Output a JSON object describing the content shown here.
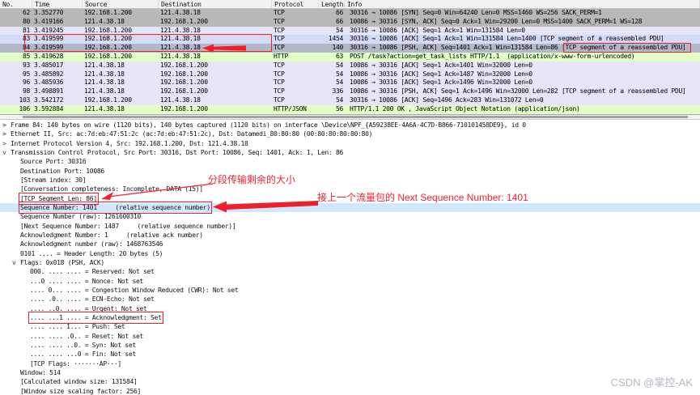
{
  "colors": {
    "gray_row": "#b8b8b8",
    "lavender_row": "#e7e6f8",
    "blue_row": "#d6dbf5",
    "selected_row": "#b4b6ca",
    "green_row": "#e3ffc8",
    "detail_selection": "#cfe8ff",
    "annotation_red": "#ee2128"
  },
  "icons": {
    "collapsed": ">",
    "expanded": "v"
  },
  "packet_list": {
    "columns": [
      "No.",
      "Time",
      "Source",
      "Destination",
      "Protocol",
      "Length",
      "Info"
    ],
    "rows": [
      {
        "no": "62",
        "time": "3.352770",
        "src": "192.168.1.200",
        "dst": "121.4.38.18",
        "proto": "TCP",
        "len": "66",
        "info": "30316 → 10086 [SYN] Seq=0 Win=64240 Len=0 MSS=1460 WS=256 SACK_PERM=1",
        "color": "gray"
      },
      {
        "no": "80",
        "time": "3.419166",
        "src": "121.4.38.18",
        "dst": "192.168.1.200",
        "proto": "TCP",
        "len": "66",
        "info": "10086 → 30316 [SYN, ACK] Seq=0 Ack=1 Win=29200 Len=0 MSS=1400 SACK_PERM=1 WS=128",
        "color": "gray"
      },
      {
        "no": "81",
        "time": "3.419245",
        "src": "192.168.1.200",
        "dst": "121.4.38.18",
        "proto": "TCP",
        "len": "54",
        "info": "30316 → 10086 [ACK] Seq=1 Ack=1 Win=131584 Len=0",
        "color": "lavender"
      },
      {
        "no": "83",
        "time": "3.419599",
        "src": "192.168.1.200",
        "dst": "121.4.38.18",
        "proto": "TCP",
        "len": "1454",
        "info": "30316 → 10086 [ACK] Seq=1 Ack=1 Win=131584 Len=1400 [TCP segment of a reassembled PDU]",
        "color": "blue"
      },
      {
        "no": "84",
        "time": "3.419599",
        "src": "192.168.1.200",
        "dst": "121.4.38.18",
        "proto": "TCP",
        "len": "140",
        "info": "30316 → 10086 [PSH, ACK] Seq=1401 Ack=1 Win=131584 Len=86 [TCP segment of a reassembled PDU]",
        "color": "selected"
      },
      {
        "no": "85",
        "time": "3.419628",
        "src": "192.168.1.200",
        "dst": "121.4.38.18",
        "proto": "HTTP",
        "len": "63",
        "info": "POST /task?action=get_task_lists HTTP/1.1  (application/x-www-form-urlencoded)",
        "color": "green"
      },
      {
        "no": "93",
        "time": "3.485017",
        "src": "121.4.38.18",
        "dst": "192.168.1.200",
        "proto": "TCP",
        "len": "54",
        "info": "10086 → 30316 [ACK] Seq=1 Ack=1401 Win=32000 Len=0",
        "color": "lavender"
      },
      {
        "no": "95",
        "time": "3.485892",
        "src": "121.4.38.18",
        "dst": "192.168.1.200",
        "proto": "TCP",
        "len": "54",
        "info": "10086 → 30316 [ACK] Seq=1 Ack=1487 Win=32000 Len=0",
        "color": "lavender"
      },
      {
        "no": "96",
        "time": "3.485936",
        "src": "121.4.38.18",
        "dst": "192.168.1.200",
        "proto": "TCP",
        "len": "54",
        "info": "10086 → 30316 [ACK] Seq=1 Ack=1496 Win=32000 Len=0",
        "color": "lavender"
      },
      {
        "no": "98",
        "time": "3.498891",
        "src": "121.4.38.18",
        "dst": "192.168.1.200",
        "proto": "TCP",
        "len": "336",
        "info": "10086 → 30316 [PSH, ACK] Seq=1 Ack=1496 Win=32000 Len=282 [TCP segment of a reassembled PDU]",
        "color": "lavender"
      },
      {
        "no": "103",
        "time": "3.542172",
        "src": "192.168.1.200",
        "dst": "121.4.38.18",
        "proto": "TCP",
        "len": "54",
        "info": "30316 → 10086 [ACK] Seq=1496 Ack=283 Win=131072 Len=0",
        "color": "lavender"
      },
      {
        "no": "106",
        "time": "3.592884",
        "src": "121.4.38.18",
        "dst": "192.168.1.200",
        "proto": "HTTP/JSON",
        "len": "56",
        "info": "HTTP/1.1 200 OK , JavaScript Object Notation (application/json)",
        "color": "green"
      }
    ]
  },
  "details": [
    {
      "t": "Frame 84: 140 bytes on wire (1120 bits), 140 bytes captured (1120 bits) on interface \\Device\\NPF_{A59238EE-4A6A-4C7D-B866-710101458DE9}, id 0",
      "ind": "ind0",
      "arrow": "collapsed"
    },
    {
      "t": "Ethernet II, Src: ac:7d:eb:47:51:2c (ac:7d:eb:47:51:2c), Dst: Datamedi_80:80:80 (00:80:80:80:80:80)",
      "ind": "ind0",
      "arrow": "collapsed"
    },
    {
      "t": "Internet Protocol Version 4, Src: 192.168.1.200, Dst: 121.4.38.18",
      "ind": "ind0",
      "arrow": "collapsed"
    },
    {
      "t": "Transmission Control Protocol, Src Port: 30316, Dst Port: 10086, Seq: 1401, Ack: 1, Len: 86",
      "ind": "ind0",
      "arrow": "expanded"
    },
    {
      "t": "Source Port: 30316",
      "ind": "ind1"
    },
    {
      "t": "Destination Port: 10086",
      "ind": "ind1"
    },
    {
      "t": "[Stream index: 30]",
      "ind": "ind1"
    },
    {
      "t": "[Conversation completeness: Incomplete, DATA (15)]",
      "ind": "ind1"
    },
    {
      "t": "[TCP Segment Len: 86]",
      "ind": "ind1",
      "box": true
    },
    {
      "t": "Sequence Number: 1401     (relative sequence number)",
      "ind": "ind1",
      "box": true,
      "sel": true
    },
    {
      "t": "Sequence Number (raw): 1261600310",
      "ind": "ind1"
    },
    {
      "t": "[Next Sequence Number: 1487     (relative sequence number)]",
      "ind": "ind1"
    },
    {
      "t": "Acknowledgment Number: 1     (relative ack number)",
      "ind": "ind1"
    },
    {
      "t": "Acknowledgment number (raw): 1468763546",
      "ind": "ind1"
    },
    {
      "t": "0101 .... = Header Length: 20 bytes (5)",
      "ind": "ind1"
    },
    {
      "t": "Flags: 0x018 (PSH, ACK)",
      "ind": "ind1",
      "arrow": "expanded"
    },
    {
      "t": "000. .... .... = Reserved: Not set",
      "ind": "ind2"
    },
    {
      "t": "...0 .... .... = Nonce: Not set",
      "ind": "ind2"
    },
    {
      "t": ".... 0... .... = Congestion Window Reduced (CWR): Not set",
      "ind": "ind2"
    },
    {
      "t": ".... .0.. .... = ECN-Echo: Not set",
      "ind": "ind2"
    },
    {
      "t": ".... ..0. .... = Urgent: Not set",
      "ind": "ind2"
    },
    {
      "t": ".... ...1 .... = Acknowledgment: Set",
      "ind": "ind2",
      "box": true
    },
    {
      "t": ".... .... 1... = Push: Set",
      "ind": "ind2"
    },
    {
      "t": ".... .... .0.. = Reset: Not set",
      "ind": "ind2"
    },
    {
      "t": ".... .... ..0. = Syn: Not set",
      "ind": "ind2"
    },
    {
      "t": ".... .... ...0 = Fin: Not set",
      "ind": "ind2"
    },
    {
      "t": "[TCP Flags: ·······AP···]",
      "ind": "ind2"
    },
    {
      "t": "Window: 514",
      "ind": "ind1"
    },
    {
      "t": "[Calculated window size: 131584]",
      "ind": "ind1"
    },
    {
      "t": "[Window size scaling factor: 256]",
      "ind": "ind1"
    }
  ],
  "annotations": {
    "segment_size_note": "分段传输剩余的大小",
    "sequence_note": "接上一个流量包的 Next Sequence Number: 1401"
  },
  "watermark": "CSDN @掌控-AK"
}
